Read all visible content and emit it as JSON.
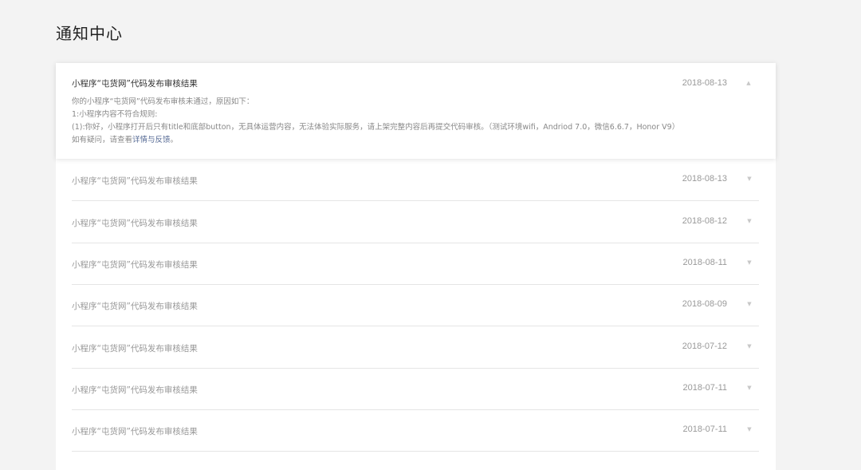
{
  "page_title": "通知中心",
  "expanded": {
    "title": "小程序“屯货网”代码发布审核结果",
    "date": "2018-08-13",
    "icon": "chevron-up-icon",
    "lines": [
      "你的小程序“屯货网”代码发布审核未通过，原因如下：",
      "1:小程序内容不符合规则:",
      "(1):你好，小程序打开后只有title和底部button，无具体运营内容，无法体验实际服务，请上架完整内容后再提交代码审核。（测试环境wifi，Andriod 7.0，微信6.6.7，Honor V9）"
    ],
    "footer_prefix": "如有疑问，请查看",
    "footer_link": "详情与反馈",
    "footer_suffix": "。"
  },
  "rows": [
    {
      "title": "小程序“屯货网”代码发布审核结果",
      "date": "2018-08-13"
    },
    {
      "title": "小程序“屯货网”代码发布审核结果",
      "date": "2018-08-12"
    },
    {
      "title": "小程序“屯货网”代码发布审核结果",
      "date": "2018-08-11"
    },
    {
      "title": "小程序“屯货网”代码发布审核结果",
      "date": "2018-08-09"
    },
    {
      "title": "小程序“屯货网”代码发布审核结果",
      "date": "2018-07-12"
    },
    {
      "title": "小程序“屯货网”代码发布审核结果",
      "date": "2018-07-11"
    },
    {
      "title": "小程序“屯货网”代码发布审核结果",
      "date": "2018-07-11"
    }
  ],
  "colors": {
    "background": "#f3f3f3",
    "card": "#ffffff",
    "link": "#576b95",
    "muted": "#999999"
  }
}
